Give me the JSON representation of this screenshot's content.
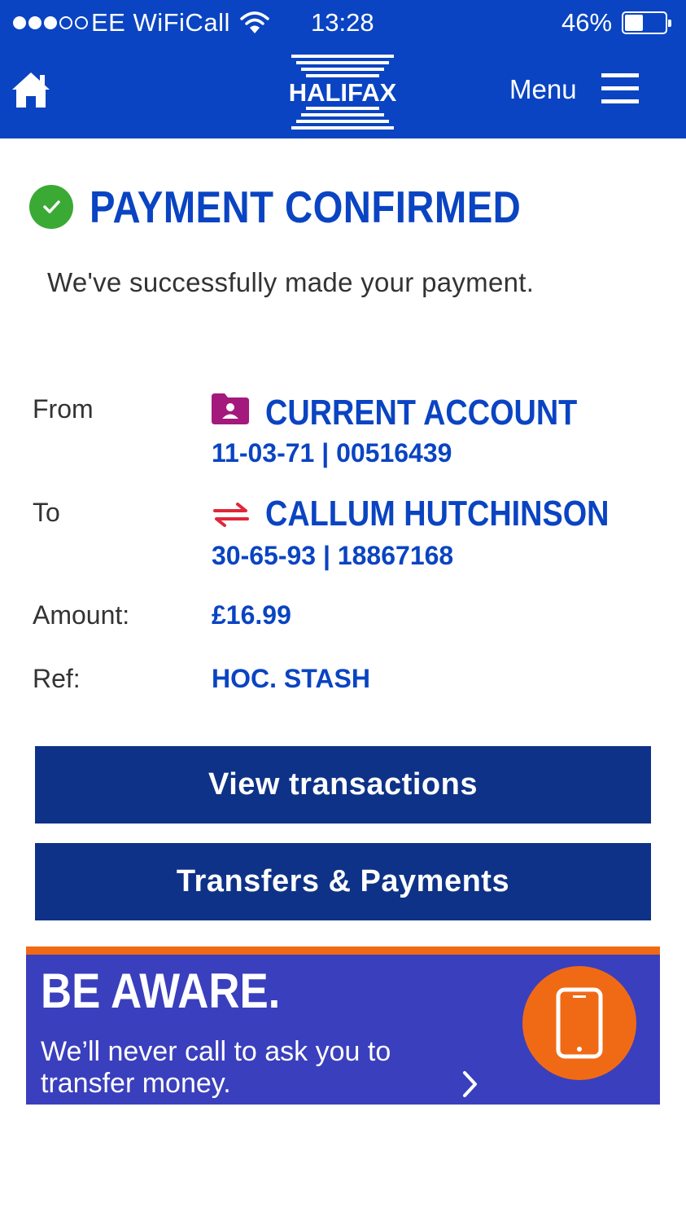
{
  "status_bar": {
    "carrier": "EE WiFiCall",
    "time": "13:28",
    "battery": "46%",
    "battery_level": 0.46,
    "signal_bars_filled": 3,
    "signal_bars_total": 5
  },
  "header": {
    "brand": "HALIFAX",
    "menu_label": "Menu",
    "home_icon": "home-icon",
    "menu_icon": "hamburger-icon",
    "bg_color": "#0a44c2"
  },
  "confirmation": {
    "title": "PAYMENT CONFIRMED",
    "message": "We've successfully made your payment.",
    "icon": "check-circle-icon",
    "icon_color": "#3aaa35"
  },
  "details": {
    "from_label": "From",
    "from_account_name": "CURRENT ACCOUNT",
    "from_account_number": "11-03-71 | 00516439",
    "from_icon": "account-icon",
    "to_label": "To",
    "to_payee_name": "CALLUM HUTCHINSON",
    "to_payee_number": "30-65-93 | 18867168",
    "to_icon": "transfer-arrows-icon",
    "amount_label": "Amount:",
    "amount_value": "£16.99",
    "ref_label": "Ref:",
    "ref_value": "HOC. STASH"
  },
  "actions": {
    "view_transactions": "View transactions",
    "transfers_payments": "Transfers & Payments",
    "button_color": "#0e3287"
  },
  "banner": {
    "title": "BE AWARE.",
    "text": "We’ll never call to ask you to transfer money.",
    "icon": "mobile-phone-icon",
    "chevron": "chevron-right-icon",
    "bg_color": "#3a3fbd",
    "accent_color": "#f06a16"
  }
}
